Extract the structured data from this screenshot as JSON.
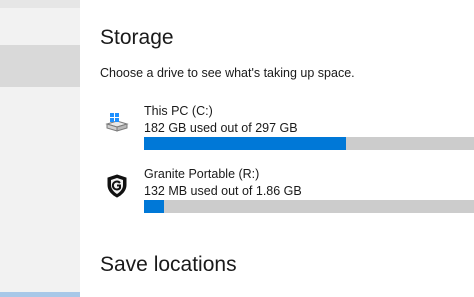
{
  "storage": {
    "title": "Storage",
    "description": "Choose a drive to see what's taking up space.",
    "drives": [
      {
        "name": "This PC (C:)",
        "usage": "182 GB used out of 297 GB",
        "used_fraction": 0.613,
        "icon": "windows-drive-icon",
        "bar_color": "#0078d7"
      },
      {
        "name": "Granite Portable (R:)",
        "usage": "132 MB used out of 1.86 GB",
        "used_fraction": 0.06,
        "icon": "shield-drive-icon",
        "bar_color": "#0078d7"
      }
    ]
  },
  "save_locations": {
    "title": "Save locations"
  },
  "colors": {
    "accent": "#0078d7",
    "bar_track": "#cccccc",
    "nav_background": "#f2f2f2",
    "nav_selected": "#d9d9d9"
  }
}
